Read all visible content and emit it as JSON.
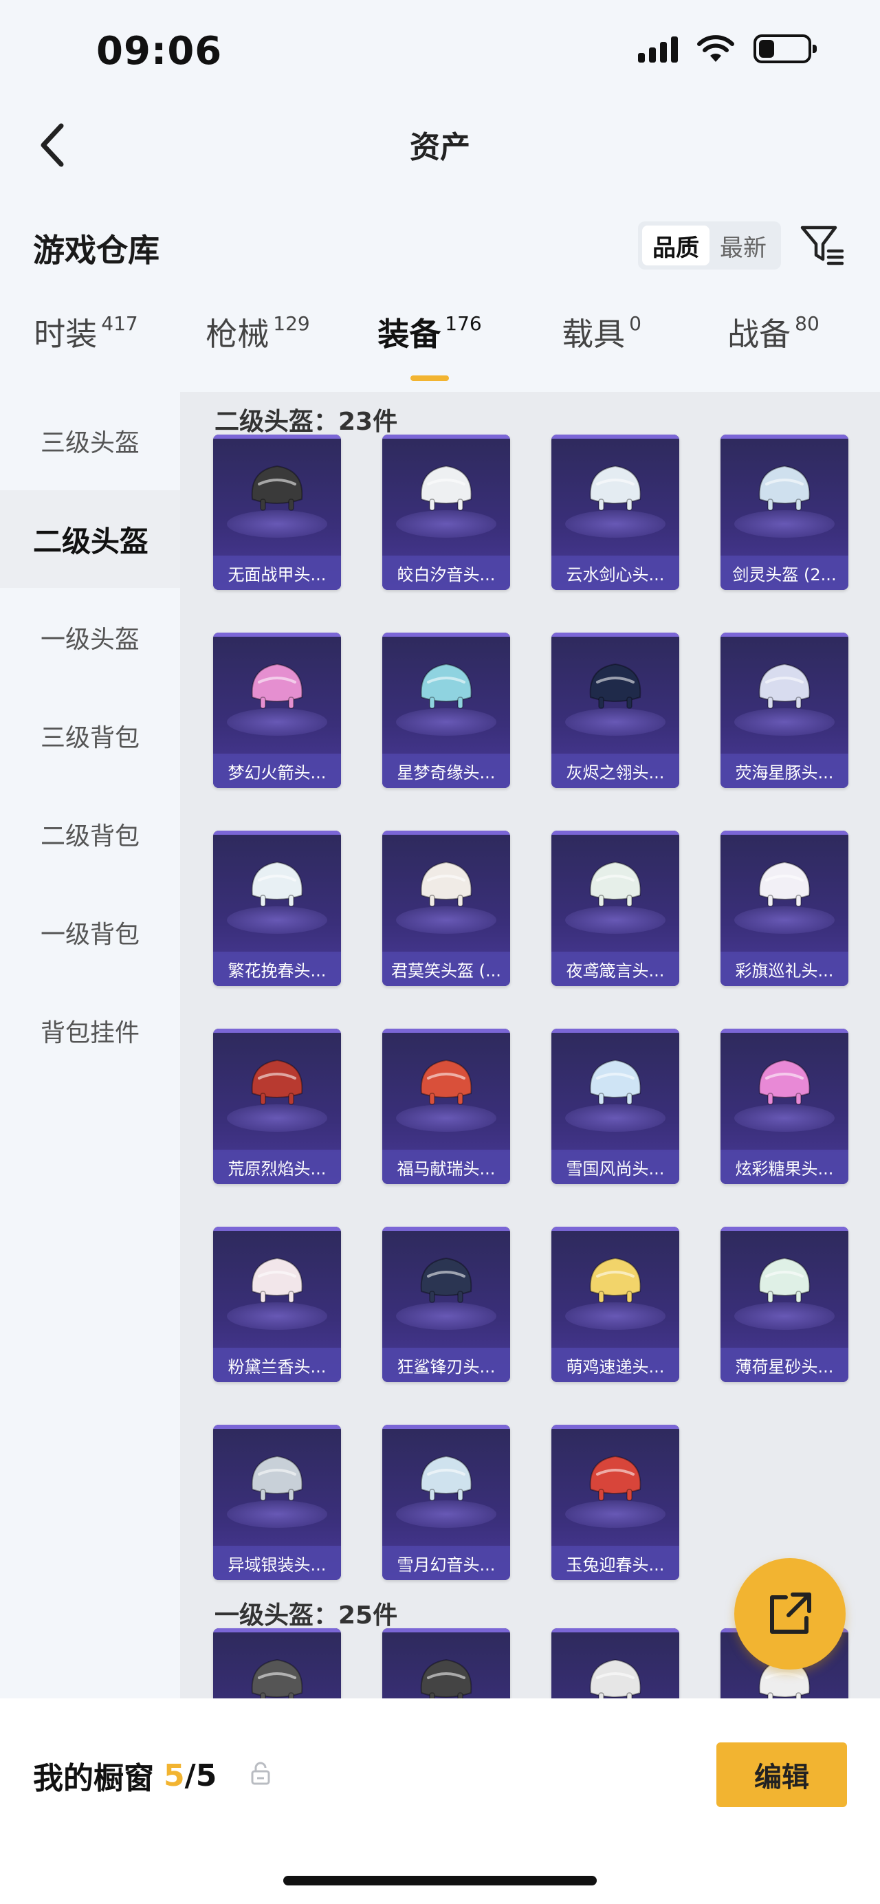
{
  "status": {
    "time": "09:06"
  },
  "nav": {
    "title": "资产"
  },
  "header": {
    "title": "游戏仓库",
    "sort_options": [
      "品质",
      "最新"
    ],
    "active_sort": 0
  },
  "category_tabs": [
    {
      "label": "时装",
      "count": "417"
    },
    {
      "label": "枪械",
      "count": "129"
    },
    {
      "label": "装备",
      "count": "176",
      "active": true
    },
    {
      "label": "载具",
      "count": "0"
    },
    {
      "label": "战备",
      "count": "80"
    }
  ],
  "sidebar": [
    {
      "label": "三级头盔"
    },
    {
      "label": "二级头盔",
      "active": true
    },
    {
      "label": "一级头盔"
    },
    {
      "label": "三级背包"
    },
    {
      "label": "二级背包"
    },
    {
      "label": "一级背包"
    },
    {
      "label": "背包挂件"
    }
  ],
  "groups": [
    {
      "title": "二级头盔：23件",
      "items": [
        {
          "name": "无面战甲头...",
          "color": "#3a3a3a"
        },
        {
          "name": "皎白汐音头...",
          "color": "#eef0f2"
        },
        {
          "name": "云水剑心头...",
          "color": "#e4ecf2"
        },
        {
          "name": "剑灵头盔 (2...",
          "color": "#cfe0ee"
        },
        {
          "name": "梦幻火箭头...",
          "color": "#e58fd0"
        },
        {
          "name": "星梦奇缘头...",
          "color": "#8fd3e0"
        },
        {
          "name": "灰烬之翎头...",
          "color": "#1f2a4a"
        },
        {
          "name": "荧海星豚头...",
          "color": "#d8dcef"
        },
        {
          "name": "繁花挽春头...",
          "color": "#e8f0f4"
        },
        {
          "name": "君莫笑头盔 (...",
          "color": "#f0ebe6"
        },
        {
          "name": "夜鸢箴言头...",
          "color": "#e6efe9"
        },
        {
          "name": "彩旗巡礼头...",
          "color": "#f2f0f6"
        },
        {
          "name": "荒原烈焰头...",
          "color": "#b83a30"
        },
        {
          "name": "福马献瑞头...",
          "color": "#d9503a"
        },
        {
          "name": "雪国风尚头...",
          "color": "#cfe4f5"
        },
        {
          "name": "炫彩糖果头...",
          "color": "#e889d6"
        },
        {
          "name": "粉黛兰香头...",
          "color": "#f2e6ea"
        },
        {
          "name": "狂鲨锋刃头...",
          "color": "#2b3552"
        },
        {
          "name": "萌鸡速递头...",
          "color": "#f2d46a"
        },
        {
          "name": "薄荷星砂头...",
          "color": "#dff0e6"
        },
        {
          "name": "异域银装头...",
          "color": "#c8d0d8"
        },
        {
          "name": "雪月幻音头...",
          "color": "#cfe2ee"
        },
        {
          "name": "玉兔迎春头...",
          "color": "#d8453a"
        }
      ]
    },
    {
      "title": "一级头盔：25件",
      "items": [
        {
          "name": "",
          "color": "#555555"
        },
        {
          "name": "",
          "color": "#444444"
        },
        {
          "name": "",
          "color": "#e6e6e6"
        },
        {
          "name": "",
          "color": "#eeeeee"
        }
      ]
    }
  ],
  "bottom": {
    "showcase_label": "我的橱窗",
    "showcase_current": "5",
    "showcase_total": "/5",
    "edit_label": "编辑"
  }
}
